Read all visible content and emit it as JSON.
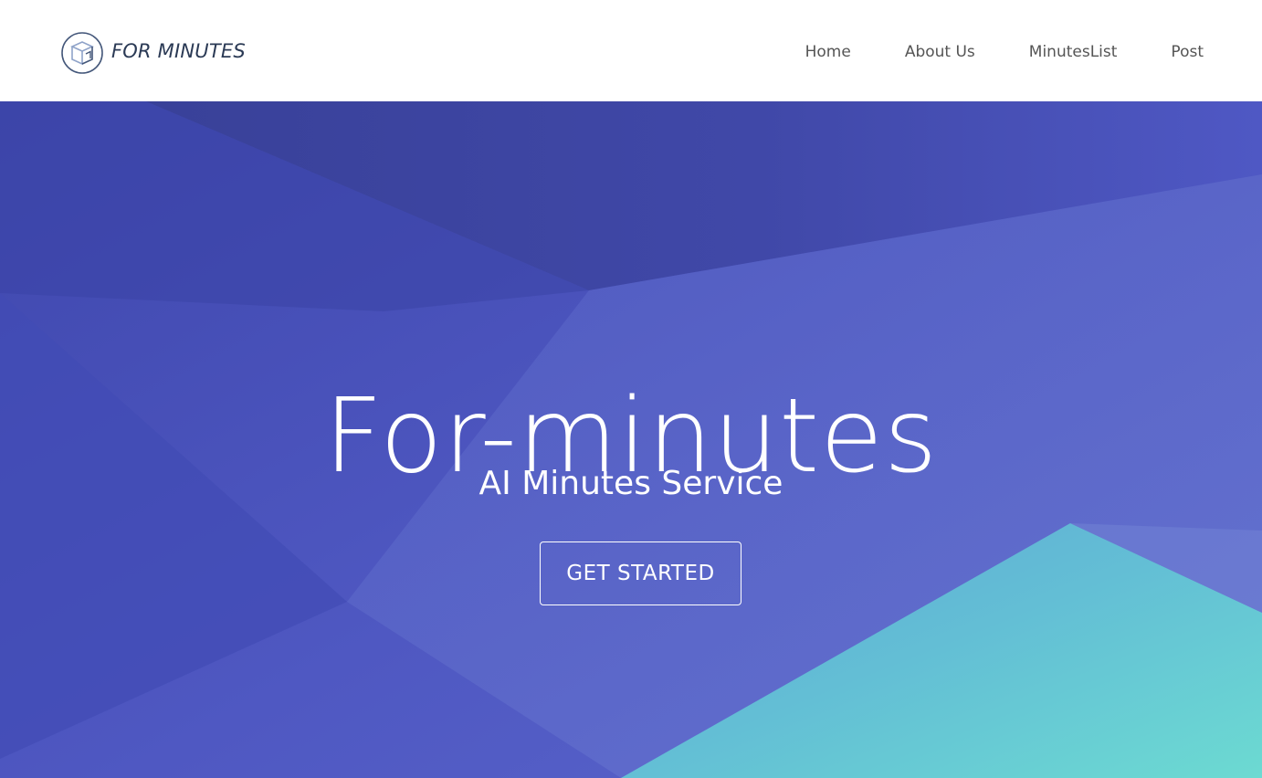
{
  "header": {
    "brand_name": "FOR MINUTES",
    "logo_icon": "box-cube-icon",
    "nav": [
      {
        "label": "Home"
      },
      {
        "label": "About Us"
      },
      {
        "label": "MinutesList"
      },
      {
        "label": "Post"
      }
    ]
  },
  "hero": {
    "title": "For-minutes",
    "subtitle": "AI Minutes Service",
    "cta_label": "GET STARTED"
  },
  "colors": {
    "primary_purple": "#4a52bd",
    "teal_accent": "#66d3d1",
    "brand_text": "#2b3a55",
    "nav_text": "#555555"
  }
}
